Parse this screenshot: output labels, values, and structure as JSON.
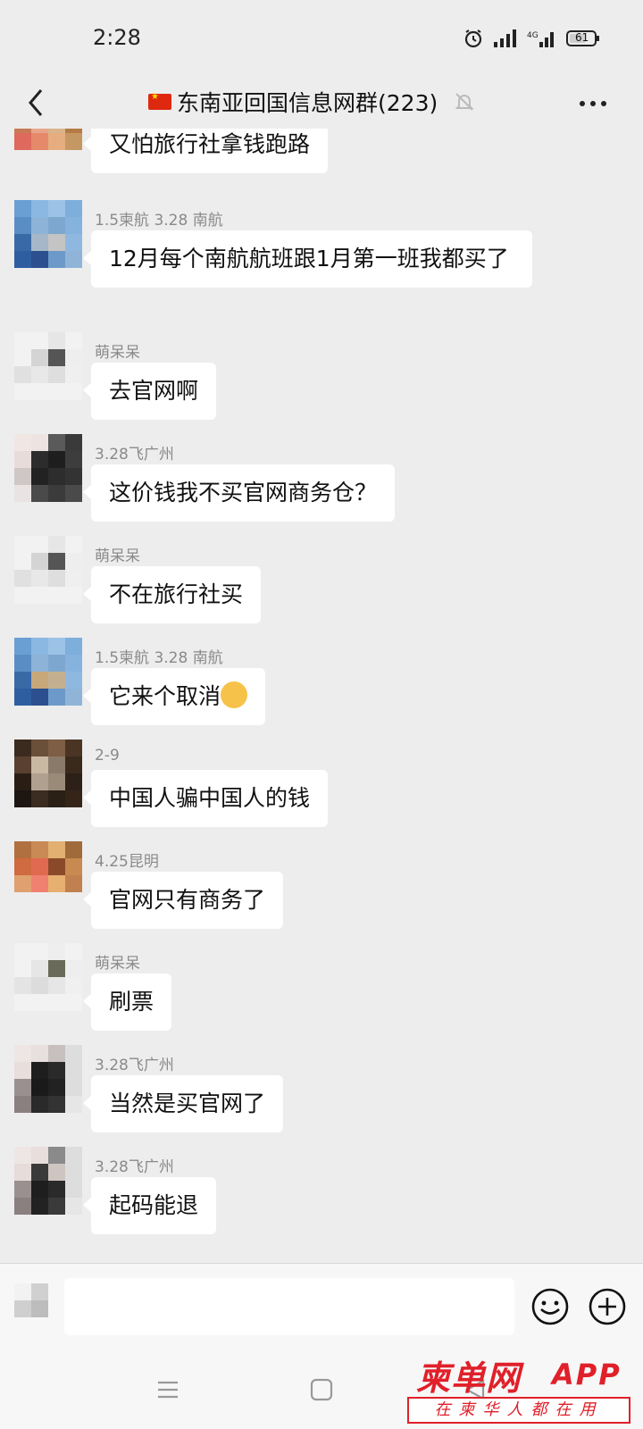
{
  "status_bar": {
    "time": "2:28",
    "battery": "61"
  },
  "header": {
    "title": "东南亚回国信息网群(223)"
  },
  "messages": [
    {
      "sender": "",
      "text": "又怕旅行社拿钱跑路"
    },
    {
      "sender": "1.5柬航 3.28 南航",
      "text": "12月每个南航航班跟1月第一班我都买了"
    },
    {
      "sender": "萌呆呆",
      "text": "去官网啊"
    },
    {
      "sender": "3.28飞广州",
      "text": "这价钱我不买官网商务仓？"
    },
    {
      "sender": "萌呆呆",
      "text": "不在旅行社买"
    },
    {
      "sender": "1.5柬航 3.28 南航",
      "text": "它来个取消"
    },
    {
      "sender": "2-9",
      "text": "中国人骗中国人的钱"
    },
    {
      "sender": "4.25昆明",
      "text": "官网只有商务了"
    },
    {
      "sender": "萌呆呆",
      "text": "刷票"
    },
    {
      "sender": "3.28飞广州",
      "text": "当然是买官网了"
    },
    {
      "sender": "3.28飞广州",
      "text": "起码能退"
    }
  ],
  "input": {
    "value": "",
    "placeholder": ""
  },
  "watermark": {
    "brand": "柬单网",
    "suffix": "APP",
    "slogan": "在柬华人都在用"
  },
  "colors": {
    "background": "#ededed",
    "bubble": "#ffffff",
    "watermark": "#e0202a"
  }
}
